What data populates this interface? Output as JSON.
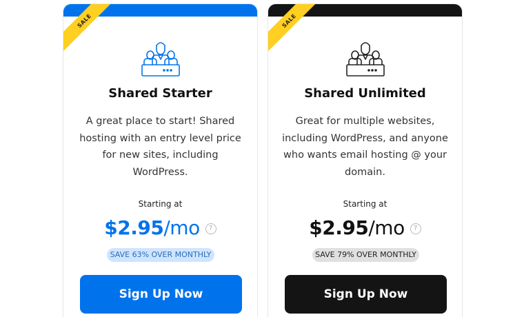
{
  "plans": [
    {
      "ribbon": "SALE",
      "icon": "shared-hosting-group-icon",
      "title": "Shared Starter",
      "description": "A great place to start! Shared hosting with an entry level price for new sites, including WordPress.",
      "starting_label": "Starting at",
      "price": "$2.95",
      "price_suffix": "/mo",
      "help_icon": "question-mark-icon",
      "save_badge": "SAVE 63% OVER MONTHLY",
      "button_label": "Sign Up Now",
      "accent": "#0073ec"
    },
    {
      "ribbon": "SALE",
      "icon": "shared-hosting-group-icon",
      "title": "Shared Unlimited",
      "description": "Great for multiple websites, including WordPress, and anyone who wants email hosting @ your domain.",
      "starting_label": "Starting at",
      "price": "$2.95",
      "price_suffix": "/mo",
      "help_icon": "question-mark-icon",
      "save_badge": "SAVE 79% OVER MONTHLY",
      "button_label": "Sign Up Now",
      "accent": "#141414"
    }
  ],
  "colors": {
    "blue": "#0073ec",
    "black": "#141414",
    "ribbon": "#ffcf21",
    "save_blue_bg": "#cfe4ff",
    "save_gray_bg": "#e0e0e0"
  }
}
